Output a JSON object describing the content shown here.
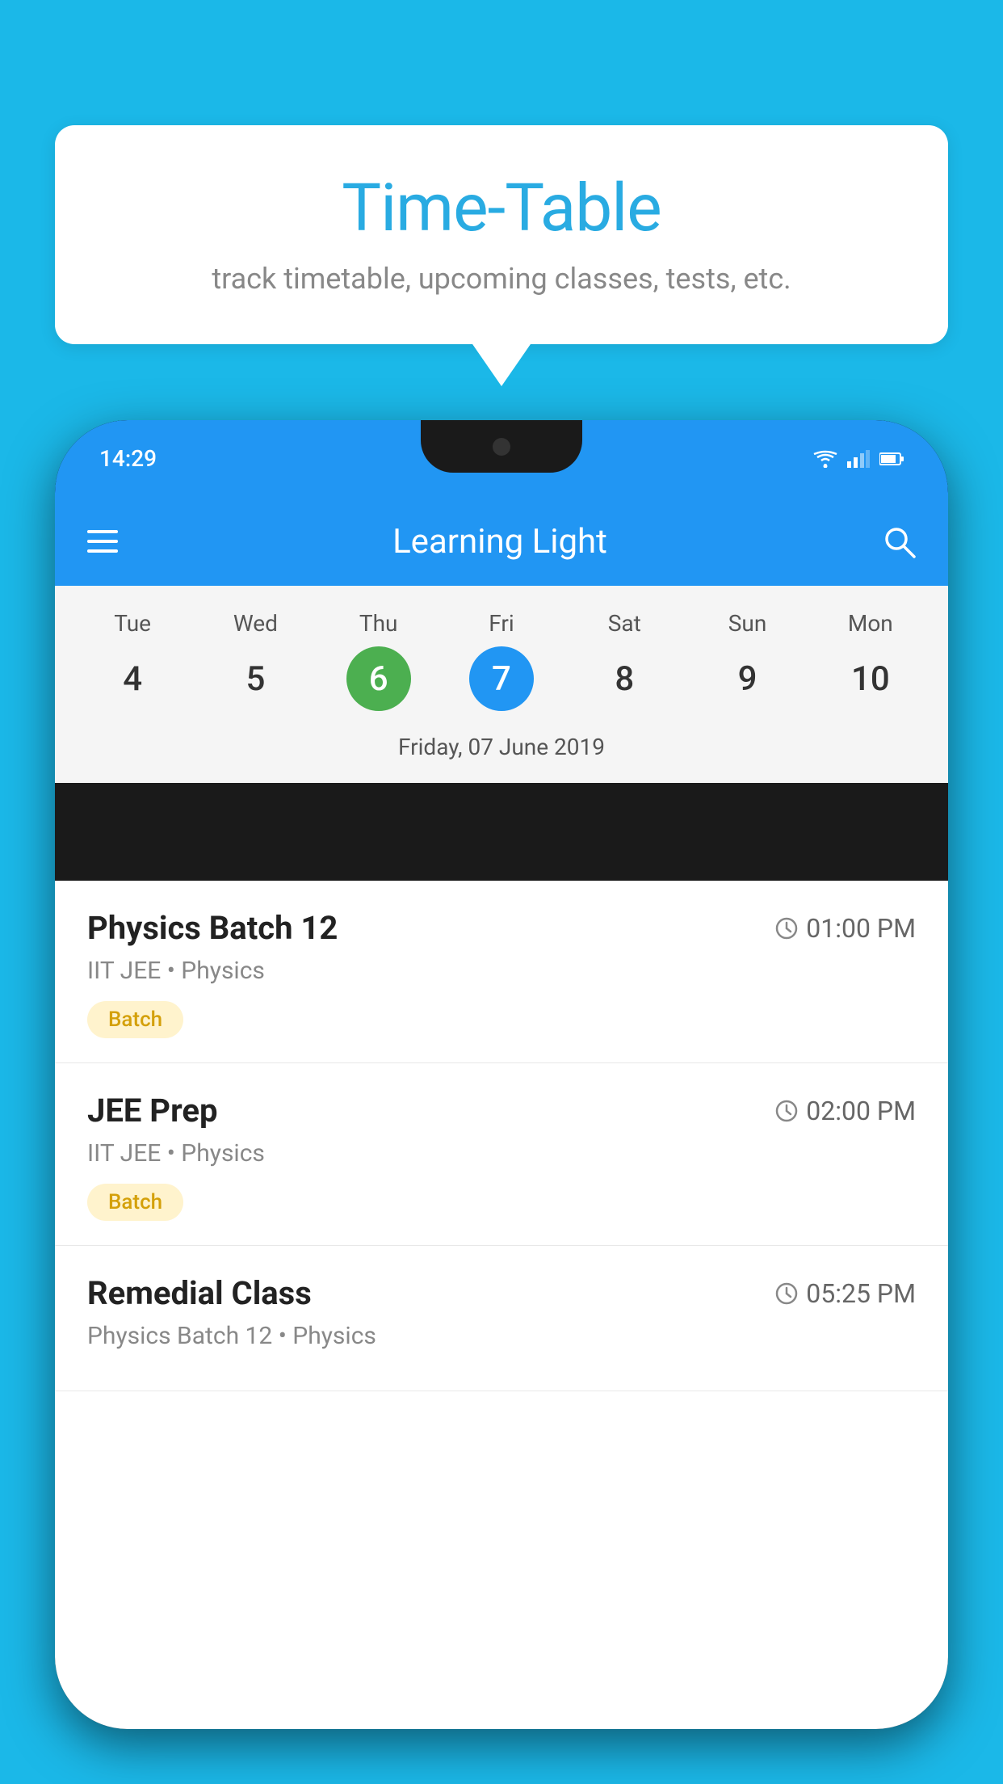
{
  "page": {
    "background_color": "#1BB8E8"
  },
  "speech_bubble": {
    "title": "Time-Table",
    "subtitle": "track timetable, upcoming classes, tests, etc."
  },
  "phone": {
    "status_bar": {
      "time": "14:29"
    },
    "app_bar": {
      "title": "Learning Light"
    },
    "calendar": {
      "selected_date_label": "Friday, 07 June 2019",
      "days": [
        {
          "name": "Tue",
          "num": "4",
          "state": "normal"
        },
        {
          "name": "Wed",
          "num": "5",
          "state": "normal"
        },
        {
          "name": "Thu",
          "num": "6",
          "state": "today"
        },
        {
          "name": "Fri",
          "num": "7",
          "state": "selected"
        },
        {
          "name": "Sat",
          "num": "8",
          "state": "normal"
        },
        {
          "name": "Sun",
          "num": "9",
          "state": "normal"
        },
        {
          "name": "Mon",
          "num": "10",
          "state": "normal"
        }
      ]
    },
    "schedule_items": [
      {
        "title": "Physics Batch 12",
        "time": "01:00 PM",
        "subtitle": "IIT JEE • Physics",
        "tag": "Batch"
      },
      {
        "title": "JEE Prep",
        "time": "02:00 PM",
        "subtitle": "IIT JEE • Physics",
        "tag": "Batch"
      },
      {
        "title": "Remedial Class",
        "time": "05:25 PM",
        "subtitle": "Physics Batch 12 • Physics",
        "tag": ""
      }
    ]
  }
}
